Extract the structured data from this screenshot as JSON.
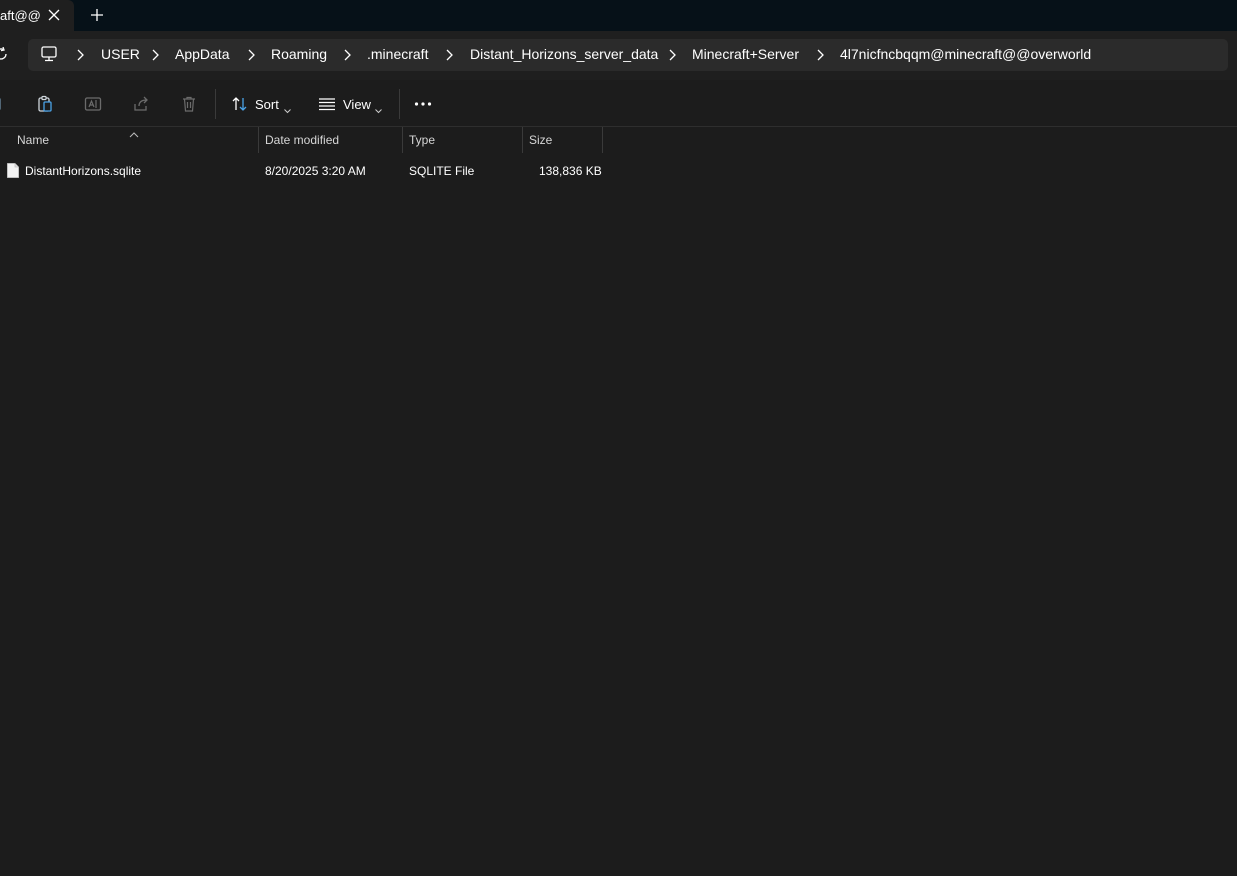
{
  "tab": {
    "title": "aft@@",
    "new_tab": "+"
  },
  "address": {
    "crumbs": [
      "USER",
      "AppData",
      "Roaming",
      ".minecraft",
      "Distant_Horizons_server_data",
      "Minecraft+Server",
      "4l7nicfncbqqm@minecraft@@overworld"
    ]
  },
  "toolbar": {
    "sort_label": "Sort",
    "view_label": "View"
  },
  "columns": {
    "name": "Name",
    "date": "Date modified",
    "type": "Type",
    "size": "Size"
  },
  "files": [
    {
      "name": "DistantHorizons.sqlite",
      "date": "8/20/2025 3:20 AM",
      "type": "SQLITE File",
      "size": "138,836 KB"
    }
  ]
}
